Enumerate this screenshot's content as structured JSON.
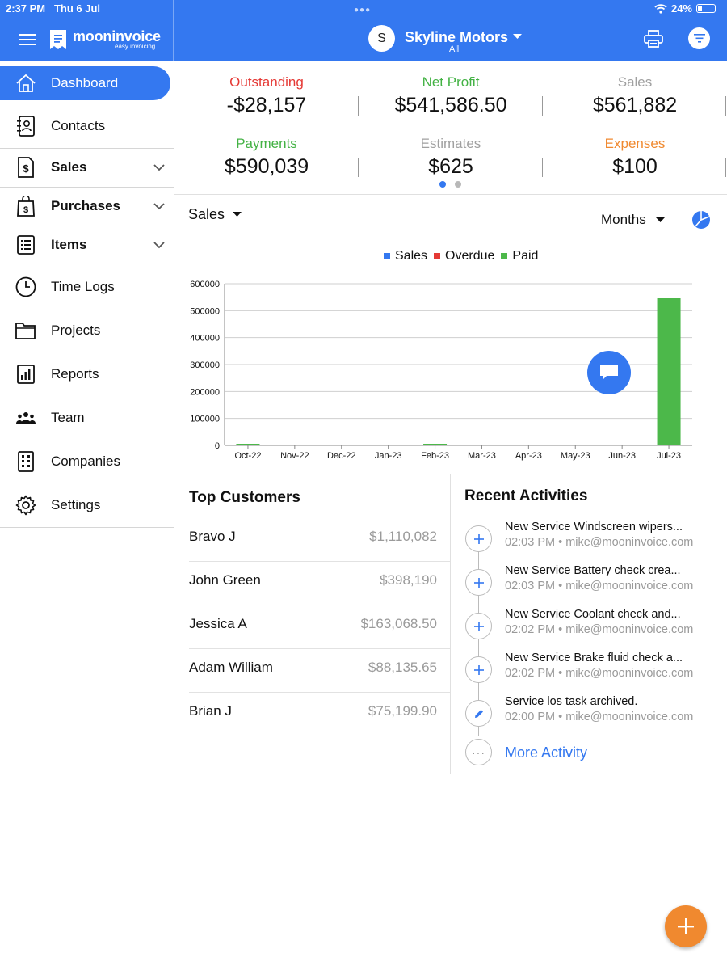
{
  "status_bar": {
    "time": "2:37 PM",
    "date": "Thu 6 Jul",
    "battery": "24%"
  },
  "header": {
    "logo_main": "mooninvoice",
    "logo_sub": "easy invoicing",
    "company_initial": "S",
    "company_name": "Skyline Motors",
    "company_sub": "All"
  },
  "sidebar": {
    "items": [
      {
        "label": "Dashboard",
        "icon": "home-icon"
      },
      {
        "label": "Contacts",
        "icon": "contacts-icon"
      },
      {
        "label": "Sales",
        "icon": "sales-icon"
      },
      {
        "label": "Purchases",
        "icon": "purchases-icon"
      },
      {
        "label": "Items",
        "icon": "items-icon"
      },
      {
        "label": "Time Logs",
        "icon": "clock-icon"
      },
      {
        "label": "Projects",
        "icon": "folder-icon"
      },
      {
        "label": "Reports",
        "icon": "reports-icon"
      },
      {
        "label": "Team",
        "icon": "team-icon"
      },
      {
        "label": "Companies",
        "icon": "companies-icon"
      },
      {
        "label": "Settings",
        "icon": "gear-icon"
      }
    ]
  },
  "stats": [
    {
      "title": "Outstanding",
      "value": "-$28,157",
      "color": "#e53935"
    },
    {
      "title": "Net Profit",
      "value": "$541,586.50",
      "color": "#43b244"
    },
    {
      "title": "Sales",
      "value": "$561,882",
      "color": "#a0a0a0"
    },
    {
      "title": "Payments",
      "value": "$590,039",
      "color": "#43b244"
    },
    {
      "title": "Estimates",
      "value": "$625",
      "color": "#a0a0a0"
    },
    {
      "title": "Expenses",
      "value": "$100",
      "color": "#f0892f"
    }
  ],
  "chart_controls": {
    "type_label": "Sales",
    "period_label": "Months"
  },
  "chart_data": {
    "type": "bar",
    "categories": [
      "Oct-22",
      "Nov-22",
      "Dec-22",
      "Jan-23",
      "Feb-23",
      "Mar-23",
      "Apr-23",
      "May-23",
      "Jun-23",
      "Jul-23"
    ],
    "series": [
      {
        "name": "Sales",
        "color": "#3478f0",
        "values": [
          0,
          0,
          0,
          0,
          0,
          0,
          0,
          0,
          0,
          0
        ]
      },
      {
        "name": "Overdue",
        "color": "#e53935",
        "values": [
          0,
          0,
          0,
          0,
          0,
          0,
          0,
          0,
          0,
          0
        ]
      },
      {
        "name": "Paid",
        "color": "#4cb84a",
        "values": [
          3000,
          0,
          0,
          0,
          6000,
          0,
          0,
          0,
          0,
          546000
        ]
      }
    ],
    "yticks": [
      "0",
      "100000",
      "200000",
      "300000",
      "400000",
      "500000",
      "600000"
    ],
    "ylim": [
      0,
      600000
    ],
    "grid": true,
    "legend": "top"
  },
  "top_customers": {
    "title": "Top Customers",
    "rows": [
      {
        "name": "Bravo J",
        "amount": "$1,110,082"
      },
      {
        "name": "John Green",
        "amount": "$398,190"
      },
      {
        "name": "Jessica A",
        "amount": "$163,068.50"
      },
      {
        "name": "Adam William",
        "amount": "$88,135.65"
      },
      {
        "name": "Brian J",
        "amount": "$75,199.90"
      }
    ]
  },
  "recent_activities": {
    "title": "Recent Activities",
    "items": [
      {
        "title": "New Service Windscreen wipers...",
        "meta": "02:03 PM • mike@mooninvoice.com",
        "icon": "plus-icon"
      },
      {
        "title": "New Service Battery check crea...",
        "meta": "02:03 PM • mike@mooninvoice.com",
        "icon": "plus-icon"
      },
      {
        "title": "New Service Coolant check and...",
        "meta": "02:02 PM • mike@mooninvoice.com",
        "icon": "plus-icon"
      },
      {
        "title": "New Service Brake fluid check a...",
        "meta": "02:02 PM • mike@mooninvoice.com",
        "icon": "plus-icon"
      },
      {
        "title": "Service los task archived.",
        "meta": "02:00 PM • mike@mooninvoice.com",
        "icon": "pencil-icon"
      }
    ],
    "more_label": "More Activity"
  }
}
